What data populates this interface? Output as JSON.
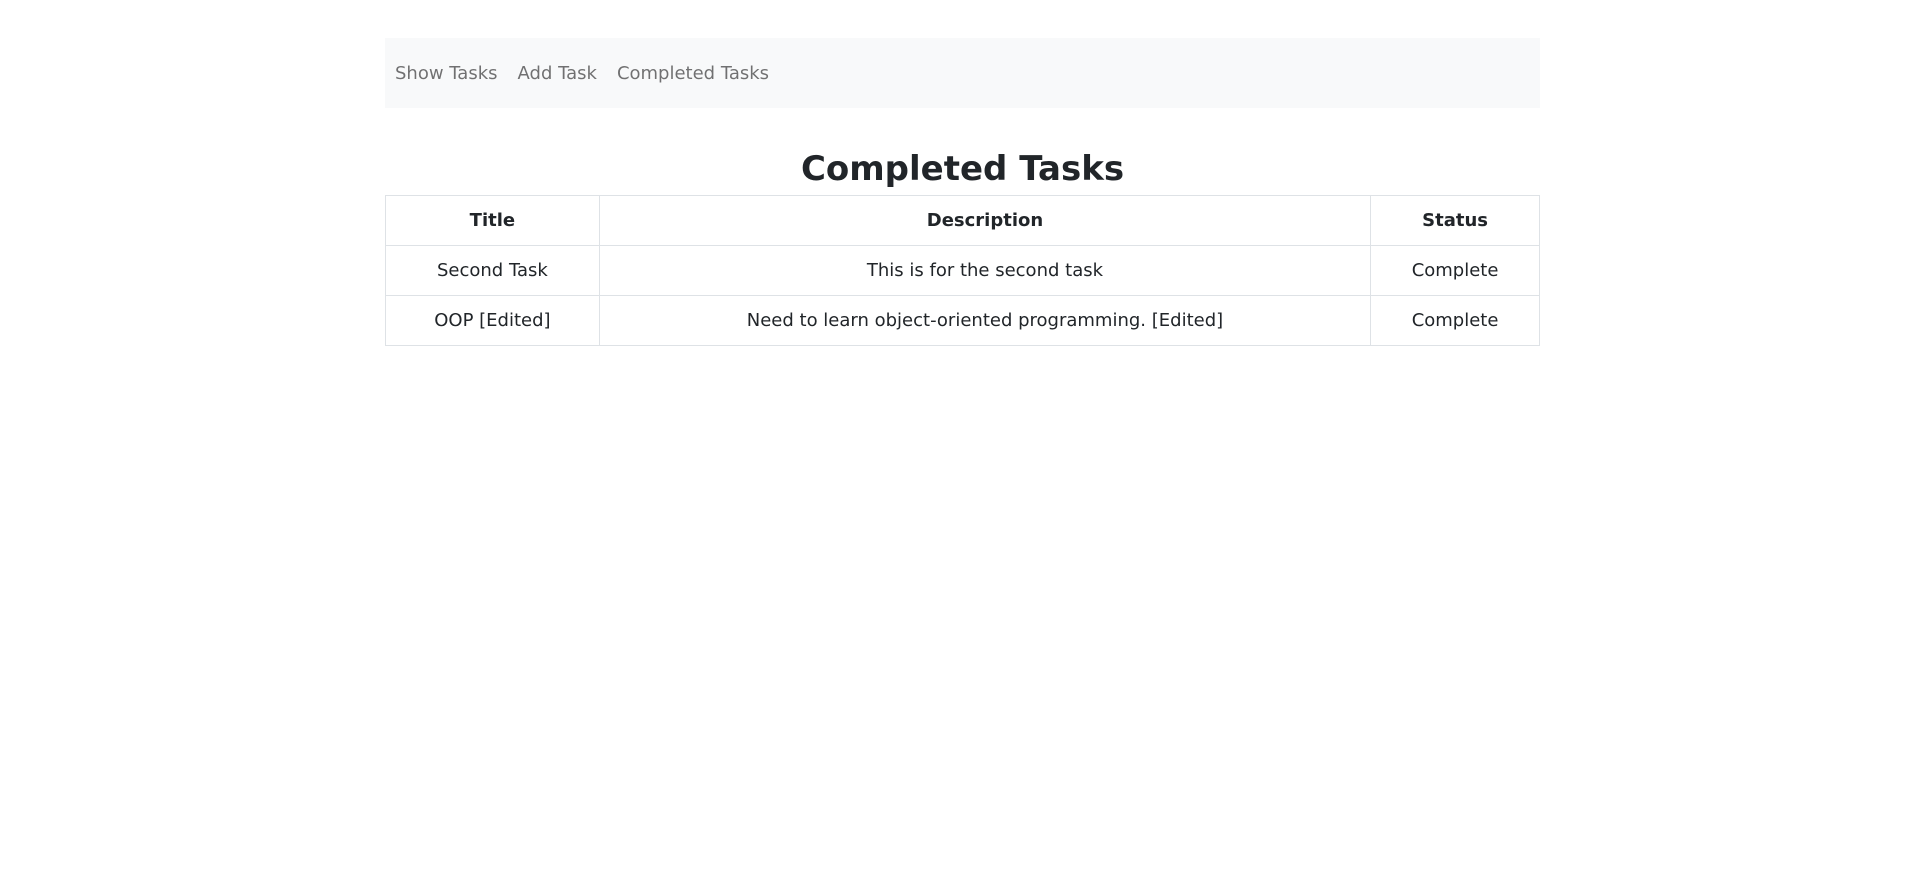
{
  "nav": {
    "items": [
      {
        "label": "Show Tasks"
      },
      {
        "label": "Add Task"
      },
      {
        "label": "Completed Tasks"
      }
    ]
  },
  "main": {
    "title": "Completed Tasks",
    "table": {
      "headers": [
        "Title",
        "Description",
        "Status"
      ],
      "rows": [
        [
          "Second Task",
          "This is for the second task",
          "Complete"
        ],
        [
          "OOP [Edited]",
          "Need to learn object-oriented programming. [Edited]",
          "Complete"
        ]
      ]
    }
  }
}
